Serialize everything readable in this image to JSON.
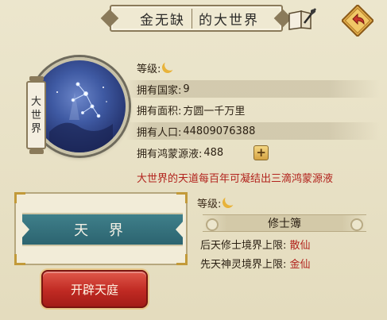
{
  "title": {
    "name": "金无缺",
    "suffix": "的大世界"
  },
  "icons": {
    "book": "book-quill-icon",
    "back": "back-arrow-icon",
    "level": "crescent-moon-icon",
    "add": "plus-icon"
  },
  "globe_tag": [
    "大",
    "世",
    "界"
  ],
  "info": {
    "level_label": "等级:",
    "countries_label": "拥有国家:",
    "countries_value": "9",
    "area_label": "拥有面积:",
    "area_value": "方圆一千万里",
    "population_label": "拥有人口:",
    "population_value": "44809076388",
    "essence_label": "拥有鸿蒙源液:",
    "essence_value": "488",
    "add_label": "+"
  },
  "notice": "大世界的天道每百年可凝结出三滴鸿蒙源液",
  "realm": {
    "name": "天 界",
    "level_label": "等级:",
    "book_title": "修士簿",
    "limit1_label": "后天修士境界上限:",
    "limit1_value": "散仙",
    "limit2_label": "先天神灵境界上限:",
    "limit2_value": "金仙",
    "open_button": "开辟天庭"
  },
  "colors": {
    "accent_red": "#b2231d",
    "banner_teal": "#2c6470",
    "button_red": "#c02a23"
  }
}
